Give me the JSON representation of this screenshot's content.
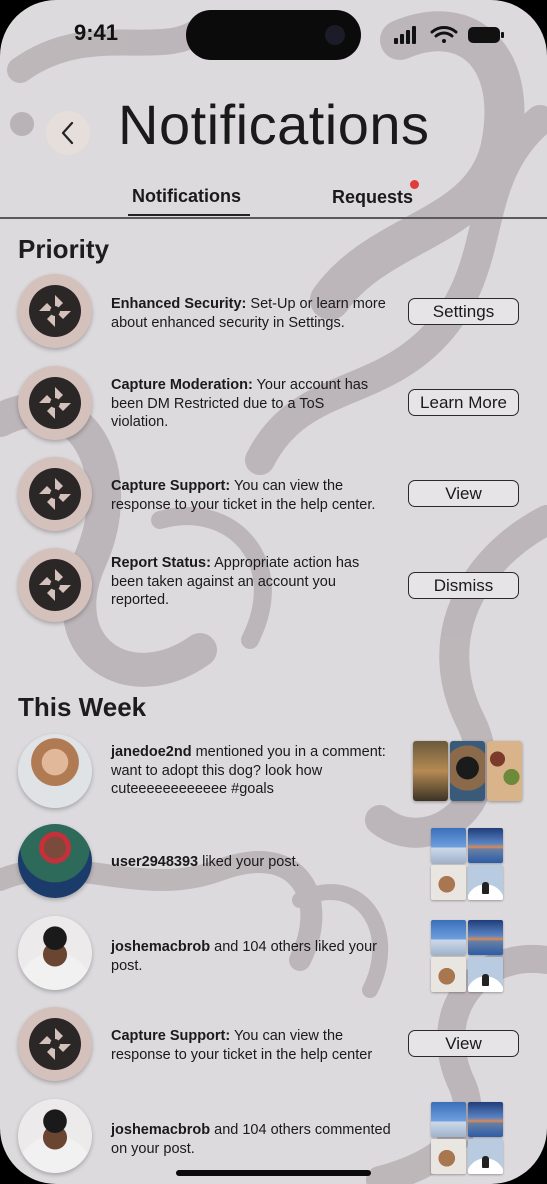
{
  "status_bar": {
    "time": "9:41"
  },
  "header": {
    "title": "Notifications",
    "back_icon": "chevron-left-icon"
  },
  "tabs": [
    {
      "label": "Notifications",
      "active": true
    },
    {
      "label": "Requests",
      "active": false,
      "has_badge": true
    }
  ],
  "colors": {
    "background": "#dcdadd",
    "avatar_bg": "#d5c1bc",
    "badge": "#e23b3b",
    "button_bg": "#e6e4e7"
  },
  "priority": {
    "title": "Priority",
    "items": [
      {
        "avatar_icon": "camera-aperture-icon",
        "bold": "Enhanced Security:",
        "text": " Set-Up or learn more about enhanced security in Settings.",
        "button": "Settings"
      },
      {
        "avatar_icon": "camera-aperture-icon",
        "bold": "Capture Moderation:",
        "text": " Your account has been DM Restricted due to a ToS violation.",
        "button": "Learn More"
      },
      {
        "avatar_icon": "camera-aperture-icon",
        "bold": "Capture Support:",
        "text": " You can view the response to your ticket in the help center.",
        "button": "View"
      },
      {
        "avatar_icon": "camera-aperture-icon",
        "bold": "Report Status:",
        "text": " Appropriate action has been taken against an account you reported.",
        "button": "Dismiss"
      }
    ]
  },
  "this_week": {
    "title": "This Week",
    "items": [
      {
        "avatar": "user-photo-janedoe2nd",
        "bold": "janedoe2nd",
        "text": " mentioned you in a comment: want to adopt this dog? look how cuteeeeeeeeeeee #goals",
        "attachment": "three-photo-strip"
      },
      {
        "avatar": "user-photo-user2948393",
        "bold": "user2948393",
        "text": " liked your post.",
        "attachment": "four-photo-grid"
      },
      {
        "avatar": "user-photo-joshemacbrob",
        "bold": "joshemacbrob",
        "text": " and 104 others liked your post.",
        "attachment": "four-photo-grid"
      },
      {
        "avatar_icon": "camera-aperture-icon",
        "bold": "Capture Support:",
        "text": " You can view the response to your ticket in the help center",
        "button": "View"
      },
      {
        "avatar": "user-photo-joshemacbrob",
        "bold": "joshemacbrob",
        "text": " and 104 others commented on your post.",
        "attachment": "four-photo-grid"
      }
    ]
  }
}
